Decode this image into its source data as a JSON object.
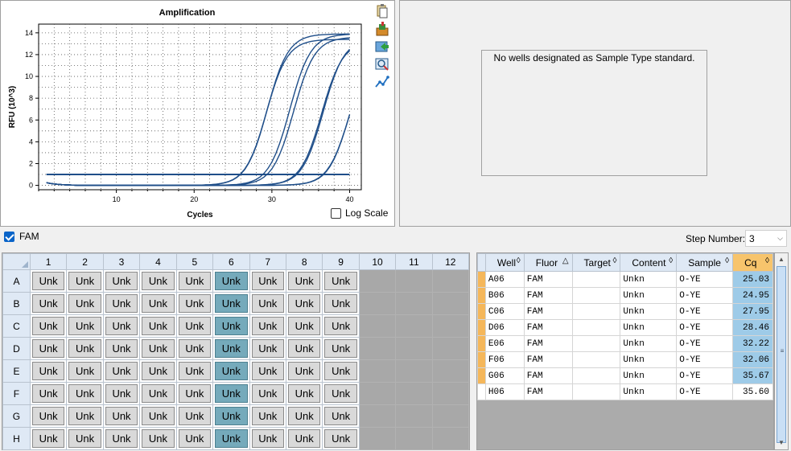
{
  "chart": {
    "title": "Amplification",
    "xlabel": "Cycles",
    "ylabel": "RFU (10^3)",
    "log_scale_label": "Log Scale",
    "log_scale_checked": false,
    "line_color": "#1f4e89"
  },
  "chart_data": {
    "type": "line",
    "title": "Amplification",
    "xlabel": "Cycles",
    "ylabel": "RFU (10^3)",
    "xlim": [
      0,
      41.5
    ],
    "ylim": [
      -0.4,
      14.8
    ],
    "xticks": [
      10,
      20,
      30,
      40
    ],
    "yticks": [
      0,
      2,
      4,
      6,
      8,
      10,
      12,
      14
    ],
    "grid": true,
    "threshold": 1.0,
    "series": [
      {
        "well": "A06",
        "cq": 25.03,
        "max": 13.9,
        "mid": 29.4,
        "slope": 1.35
      },
      {
        "well": "B06",
        "cq": 24.95,
        "max": 13.4,
        "mid": 29.3,
        "slope": 1.35
      },
      {
        "well": "C06",
        "cq": 27.95,
        "max": 13.9,
        "mid": 32.3,
        "slope": 1.35
      },
      {
        "well": "D06",
        "cq": 28.46,
        "max": 13.6,
        "mid": 32.8,
        "slope": 1.35
      },
      {
        "well": "E06",
        "cq": 32.22,
        "max": 13.5,
        "mid": 36.6,
        "slope": 1.35
      },
      {
        "well": "F06",
        "cq": 32.06,
        "max": 13.2,
        "mid": 36.4,
        "slope": 1.35
      },
      {
        "well": "G06",
        "cq": 35.67,
        "max": 13.0,
        "mid": 40.0,
        "slope": 1.35
      },
      {
        "well": "H06",
        "cq": 35.6,
        "max": 13.0,
        "mid": 40.0,
        "slope": 1.38
      }
    ]
  },
  "toolbar_icons": [
    "copy-icon",
    "export-icon",
    "refresh-icon",
    "zoom-icon",
    "graph-settings-icon"
  ],
  "standards": {
    "message": "No wells designated as Sample Type standard."
  },
  "fluor": {
    "label": "FAM",
    "checked": true
  },
  "step": {
    "label": "Step Number:",
    "value": "3"
  },
  "plate": {
    "columns": [
      "1",
      "2",
      "3",
      "4",
      "5",
      "6",
      "7",
      "8",
      "9",
      "10",
      "11",
      "12"
    ],
    "rows": [
      "A",
      "B",
      "C",
      "D",
      "E",
      "F",
      "G",
      "H"
    ],
    "well_label": "Unk",
    "filled_columns": 9,
    "selected_column": 6
  },
  "results": {
    "headers": [
      "Well",
      "Fluor",
      "Target",
      "Content",
      "Sample",
      "Cq"
    ],
    "rows": [
      {
        "well": "A06",
        "fluor": "FAM",
        "target": "",
        "content": "Unkn",
        "sample": "O-YE",
        "cq": "25.03",
        "highlight": true
      },
      {
        "well": "B06",
        "fluor": "FAM",
        "target": "",
        "content": "Unkn",
        "sample": "O-YE",
        "cq": "24.95",
        "highlight": true
      },
      {
        "well": "C06",
        "fluor": "FAM",
        "target": "",
        "content": "Unkn",
        "sample": "O-YE",
        "cq": "27.95",
        "highlight": true
      },
      {
        "well": "D06",
        "fluor": "FAM",
        "target": "",
        "content": "Unkn",
        "sample": "O-YE",
        "cq": "28.46",
        "highlight": true
      },
      {
        "well": "E06",
        "fluor": "FAM",
        "target": "",
        "content": "Unkn",
        "sample": "O-YE",
        "cq": "32.22",
        "highlight": true
      },
      {
        "well": "F06",
        "fluor": "FAM",
        "target": "",
        "content": "Unkn",
        "sample": "O-YE",
        "cq": "32.06",
        "highlight": true
      },
      {
        "well": "G06",
        "fluor": "FAM",
        "target": "",
        "content": "Unkn",
        "sample": "O-YE",
        "cq": "35.67",
        "highlight": true
      },
      {
        "well": "H06",
        "fluor": "FAM",
        "target": "",
        "content": "Unkn",
        "sample": "O-YE",
        "cq": "35.60",
        "highlight": false
      }
    ]
  }
}
